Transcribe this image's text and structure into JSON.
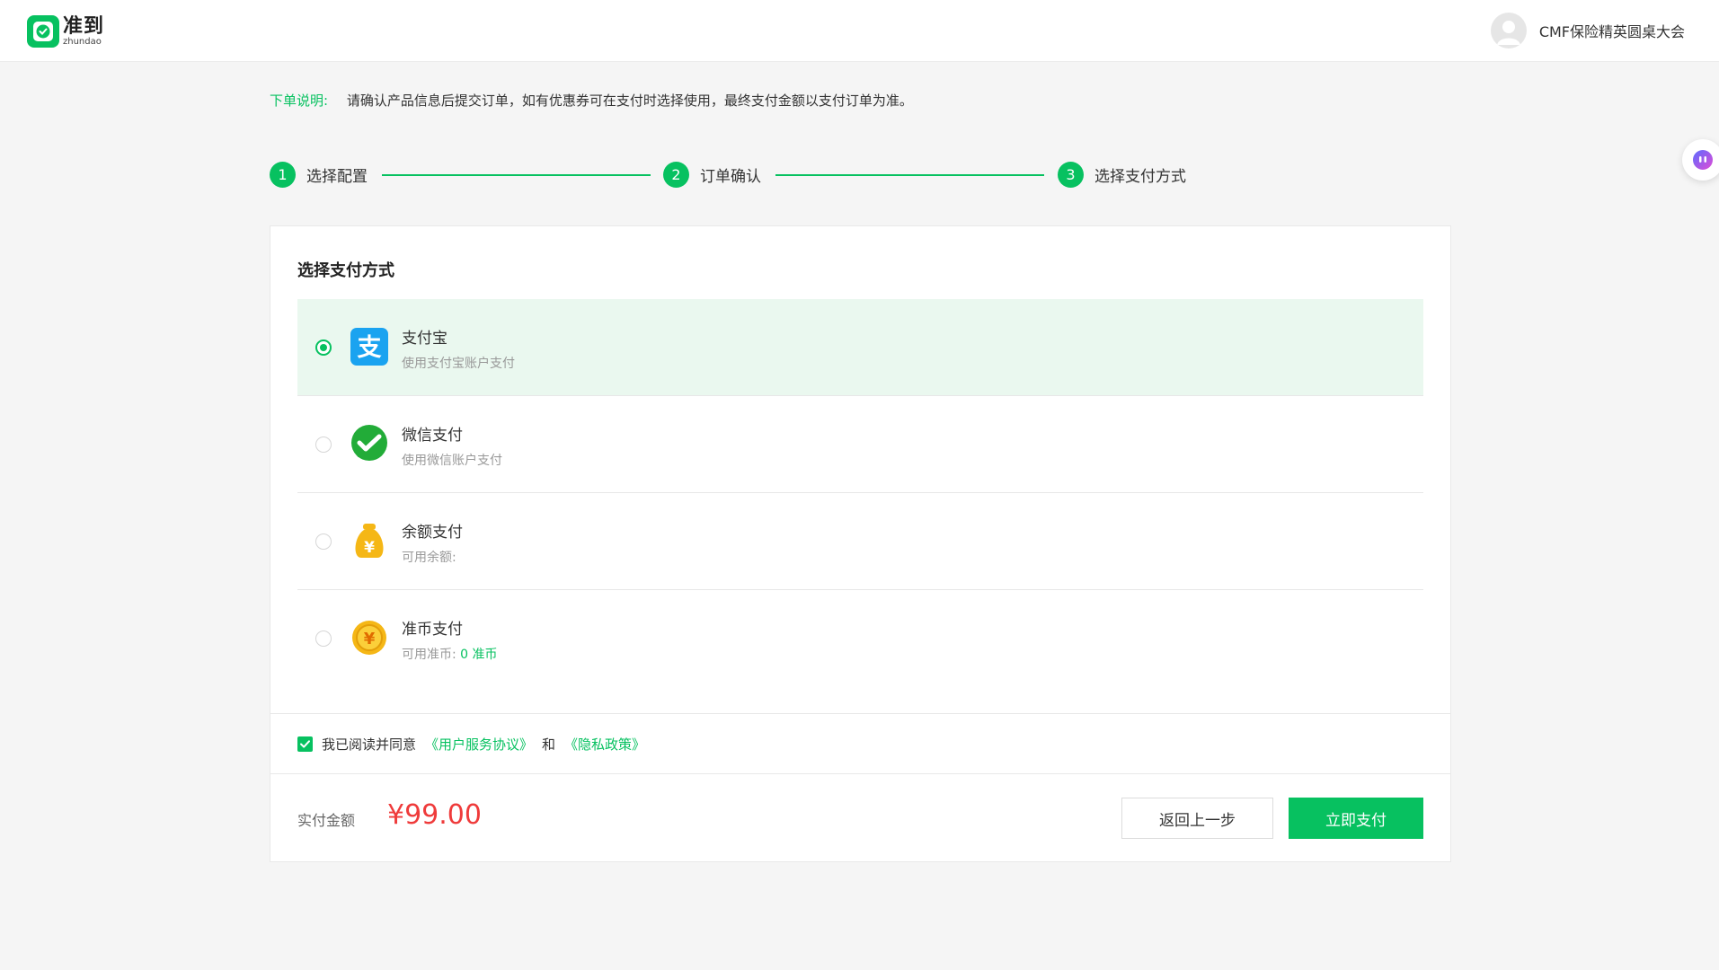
{
  "header": {
    "logo_cn": "准到",
    "logo_en": "zhundao",
    "user_name": "CMF保险精英圆桌大会"
  },
  "notice": {
    "label": "下单说明:",
    "text": "请确认产品信息后提交订单，如有优惠券可在支付时选择使用，最终支付金额以支付订单为准。"
  },
  "steps": [
    {
      "num": "1",
      "label": "选择配置"
    },
    {
      "num": "2",
      "label": "订单确认"
    },
    {
      "num": "3",
      "label": "选择支付方式"
    }
  ],
  "panel": {
    "title": "选择支付方式",
    "methods": [
      {
        "name": "支付宝",
        "desc": "使用支付宝账户支付",
        "icon": "alipay-icon",
        "selected": true
      },
      {
        "name": "微信支付",
        "desc": "使用微信账户支付",
        "icon": "wechat-pay-icon",
        "selected": false
      },
      {
        "name": "余额支付",
        "desc": "可用余额:",
        "icon": "money-bag-icon",
        "selected": false
      },
      {
        "name": "准币支付",
        "desc": "可用准币:",
        "desc_value": "0 准币",
        "icon": "coin-icon",
        "selected": false
      }
    ],
    "agree": {
      "text": "我已阅读并同意",
      "link1": "《用户服务协议》",
      "and": "和",
      "link2": "《隐私政策》",
      "checked": true
    },
    "footer": {
      "amount_label": "实付金额",
      "amount": "¥99.00",
      "back_button": "返回上一步",
      "pay_button": "立即支付"
    }
  },
  "colors": {
    "accent": "#07c160",
    "price": "#ef3b3b",
    "selected_bg": "#eaf8ef",
    "alipay": "#1aa3f0",
    "wechat": "#22ac38",
    "gold": "#f5b716"
  }
}
